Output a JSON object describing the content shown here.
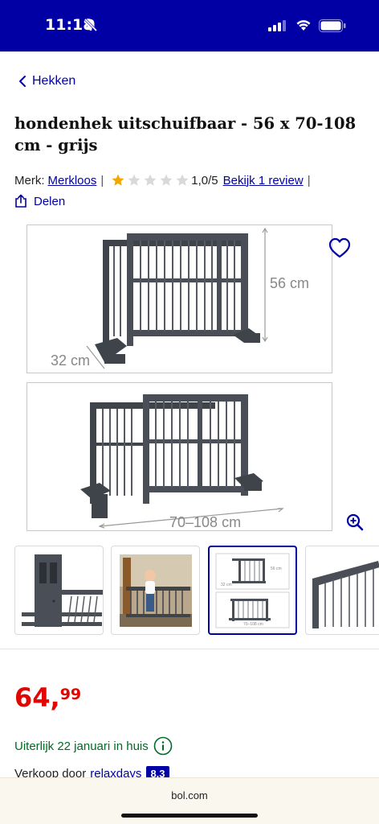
{
  "status_bar": {
    "time": "11:18"
  },
  "nav": {
    "back_label": "Hekken"
  },
  "product": {
    "title": "hondenhek uitschuifbaar - 56 x 70-108 cm - grijs",
    "brand_label": "Merk:",
    "brand_name": "Merkloos",
    "rating_value": "1,0/5",
    "rating_stars_filled": 1,
    "rating_stars_total": 5,
    "review_link": "Bekijk 1 review",
    "share_label": "Delen"
  },
  "gallery": {
    "image1_height_label": "56 cm",
    "image1_depth_label": "32 cm",
    "image2_width_label": "70–108 cm",
    "thumb_height_label": "56 cm",
    "thumb_depth_label": "32 cm",
    "thumb_width_label": "70–108 cm",
    "thumbnails": [
      "detail-closeup",
      "child-with-gate",
      "dimensions",
      "gate-angle"
    ],
    "active_thumbnail": 2
  },
  "price": {
    "main": "64,",
    "cents": "99"
  },
  "delivery": {
    "text": "Uiterlijk 22 januari in huis"
  },
  "seller": {
    "label": "Verkoop door",
    "name": "relaxdays",
    "score": "8,3"
  },
  "browser": {
    "domain": "bol.com"
  },
  "colors": {
    "brand_blue": "#0000a4",
    "price_red": "#e10600",
    "delivery_green": "#006b24",
    "star_yellow": "#f5a700",
    "star_gray": "#d9d9d9"
  }
}
